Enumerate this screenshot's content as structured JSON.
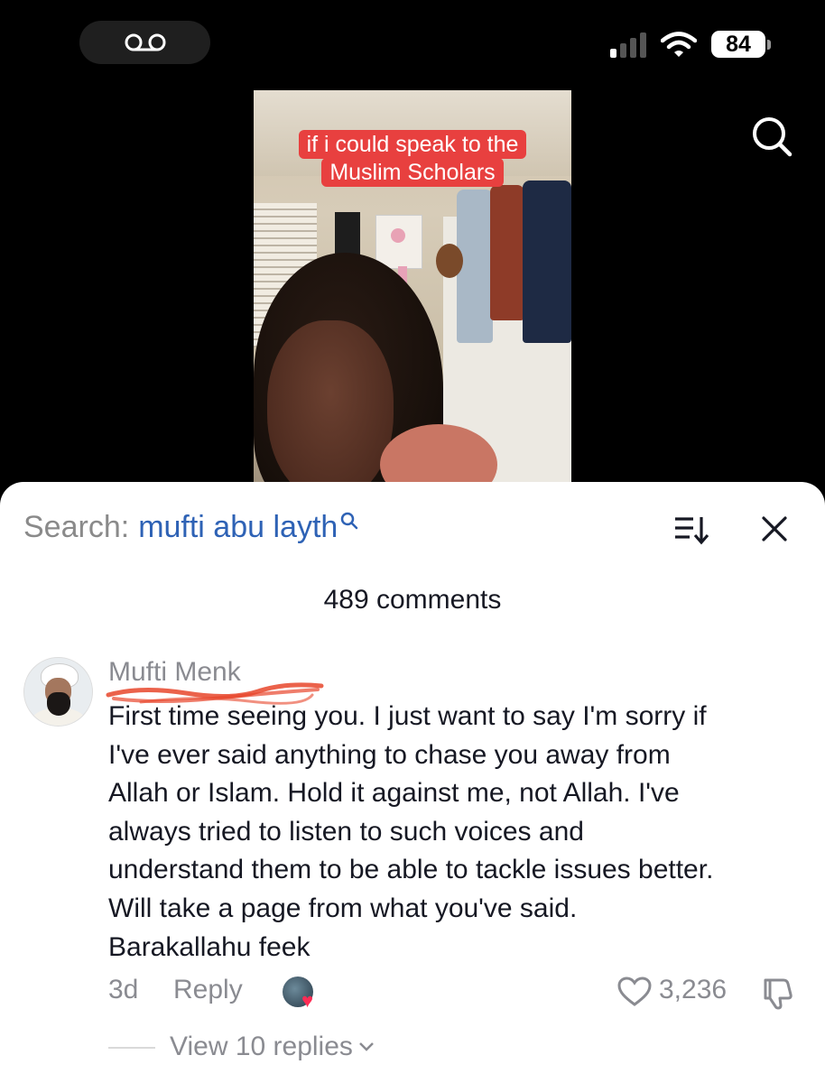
{
  "status_bar": {
    "battery": "84",
    "signal_bars_active": 1,
    "signal_bars_total": 4
  },
  "icons": {
    "voicemail": "voicemail-icon",
    "signal": "cellular-signal-icon",
    "wifi": "wifi-icon",
    "search": "search-icon",
    "sort": "sort-icon",
    "close": "close-icon",
    "like": "heart-icon",
    "dislike": "thumbs-down-icon",
    "chevron": "chevron-down-icon"
  },
  "video": {
    "caption": "if i could speak to the\nMuslim Scholars"
  },
  "comments_sheet": {
    "search_prefix": "Search:",
    "search_query": "mufti abu layth",
    "comment_count": "489 comments",
    "comment": {
      "username": "Mufti Menk",
      "text": "First time seeing you. I just want to say I'm sorry if\nI've ever said anything to chase you away from\nAllah or Islam. Hold it against me, not Allah. I've\nalways tried to listen to such voices and\nunderstand them to be able to tackle issues better.\nWill take a page from what you've said.\nBarakallahu feek",
      "time": "3d",
      "reply_label": "Reply",
      "likes": "3,236",
      "view_replies": "View 10 replies"
    }
  },
  "colors": {
    "search_query": "#2e62b5",
    "caption_bg": "#e8403f",
    "scribble": "#e8462c",
    "heart_badge": "#fe2c55"
  }
}
